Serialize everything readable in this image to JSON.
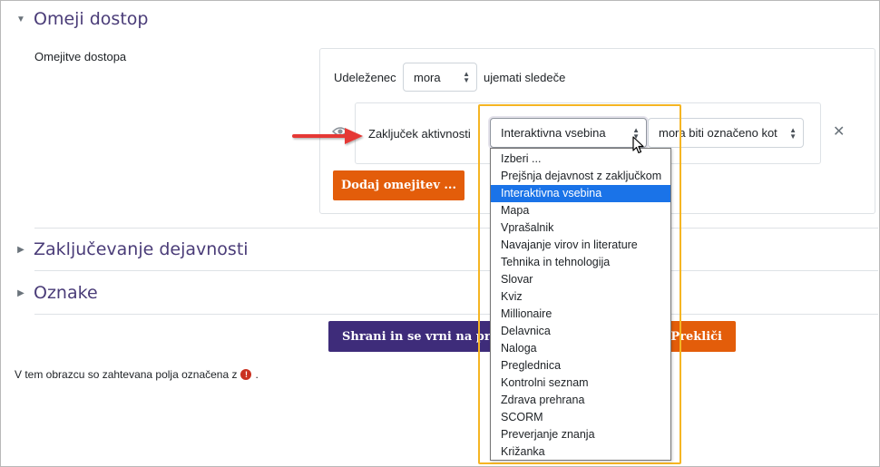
{
  "sections": {
    "restrict": {
      "title": "Omeji dostop",
      "expanded": true
    },
    "completion": {
      "title": "Zaključevanje dejavnosti"
    },
    "tags": {
      "title": "Oznake"
    }
  },
  "restrict_field": {
    "label": "Omejitve dostopa",
    "participant_label": "Udeleženec",
    "must_select_value": "mora",
    "must_suffix": "ujemati sledeče",
    "condition": {
      "label": "Zaključek aktivnosti",
      "activity_select_value": "Interaktivna vsebina",
      "state_select_value": "mora biti označeno kot"
    },
    "add_button_label": "Dodaj omejitev ..."
  },
  "dropdown": {
    "options": [
      "Izberi ...",
      "Prejšnja dejavnost z zaključkom",
      "Interaktivna vsebina",
      "Mapa",
      "Vprašalnik",
      "Navajanje virov in literature",
      "Tehnika in tehnologija",
      "Slovar",
      "Kviz",
      "Millionaire",
      "Delavnica",
      "Naloga",
      "Preglednica",
      "Kontrolni seznam",
      "Zdrava prehrana",
      "SCORM",
      "Preverjanje znanja",
      "Križanka"
    ],
    "selected_index": 2
  },
  "footer": {
    "save_return_label": "Shrani in se vrni na predmet",
    "cancel_label": "Prekliči",
    "required_note": "V tem obrazcu so zahtevana polja označena z",
    "required_note_end": "."
  },
  "colors": {
    "accent_purple": "#3e2c7a",
    "accent_orange": "#e35d0a",
    "highlight": "#f5b523",
    "selection": "#1a73e8",
    "arrow_red": "#e53935"
  }
}
